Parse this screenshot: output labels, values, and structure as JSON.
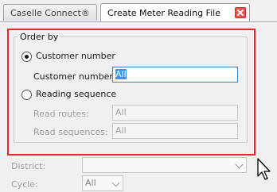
{
  "tabs": [
    {
      "label": "Caselle Connect®",
      "active": false
    },
    {
      "label": "Create Meter Reading File",
      "active": true
    }
  ],
  "order_by": {
    "title": "Order by",
    "customer_number": {
      "label": "Customer number",
      "selected": true
    },
    "customer_numbers": {
      "label": "Customer numbers:",
      "value": "All"
    },
    "read_sequence": {
      "label": "Reading sequence",
      "selected": false
    },
    "read_routes": {
      "label": "Read routes:",
      "value": "All"
    },
    "read_sequences": {
      "label": "Read sequences:",
      "value": "All"
    }
  },
  "district": {
    "label": "District:",
    "value": ""
  },
  "cycle": {
    "label": "Cycle:",
    "value": "All"
  },
  "colors": {
    "highlight": "#e8262b",
    "selection": "#3399ff",
    "close_button": "#e6534e"
  }
}
